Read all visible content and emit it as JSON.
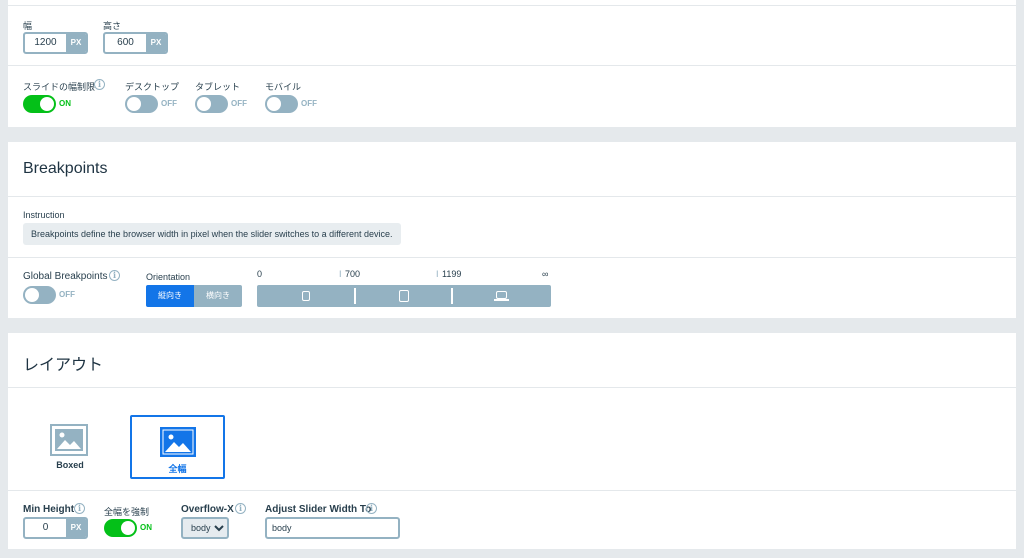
{
  "size": {
    "width_label": "幅",
    "height_label": "高さ",
    "width_value": "1200",
    "height_value": "600",
    "unit": "PX"
  },
  "limits": {
    "slide_limit_label": "スライドの幅制限",
    "slide_limit_state": "ON",
    "desktop_label": "デスクトップ",
    "desktop_state": "OFF",
    "tablet_label": "タブレット",
    "tablet_state": "OFF",
    "mobile_label": "モバイル",
    "mobile_state": "OFF"
  },
  "breakpoints": {
    "title": "Breakpoints",
    "instruction_label": "Instruction",
    "instruction_text": "Breakpoints define the browser width in pixel when the slider switches to a different device.",
    "global_label": "Global Breakpoints",
    "global_state": "OFF",
    "orientation_label": "Orientation",
    "orientation_options": [
      "縦向き",
      "横向き"
    ],
    "orientation_selected": "縦向き",
    "scale": [
      "0",
      "700",
      "1199",
      "∞"
    ]
  },
  "layout": {
    "title": "レイアウト",
    "options": [
      {
        "label": "Boxed",
        "selected": false,
        "icon": "image-boxed-icon"
      },
      {
        "label": "全幅",
        "selected": true,
        "icon": "image-fullwidth-icon"
      }
    ],
    "min_height_label": "Min Height",
    "min_height_value": "0",
    "min_height_unit": "PX",
    "force_full_label": "全幅を強制",
    "force_full_state": "ON",
    "overflow_label": "Overflow-X",
    "overflow_value": "body",
    "adjust_label": "Adjust Slider Width To",
    "adjust_value": "body"
  },
  "colors": {
    "accent": "#1375e8",
    "toggle_on": "#04c018",
    "control_gray": "#94b2c2",
    "background": "#e5e9ec"
  }
}
